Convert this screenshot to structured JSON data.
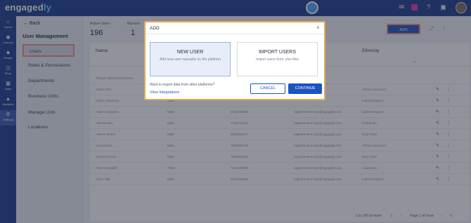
{
  "topbar": {
    "logo_main": "engaged",
    "logo_accent": "ly",
    "icons": [
      "bell-icon",
      "app-badge-icon",
      "help-icon",
      "gift-icon"
    ]
  },
  "leftnav": {
    "items": [
      {
        "icon": "home-icon",
        "label": "Home"
      },
      {
        "icon": "connect-icon",
        "label": "Connect"
      },
      {
        "icon": "people-icon",
        "label": "People"
      },
      {
        "icon": "store-icon",
        "label": "Store"
      },
      {
        "icon": "apps-icon",
        "label": "Apps"
      },
      {
        "icon": "analytics-icon",
        "label": "Analytics"
      },
      {
        "icon": "settings-icon",
        "label": "Settings"
      }
    ]
  },
  "sidebar": {
    "back_label": "Back",
    "title": "User Management",
    "items": [
      {
        "label": "Users"
      },
      {
        "label": "Roles & Permissions"
      },
      {
        "label": "Departments"
      },
      {
        "label": "Business Units"
      },
      {
        "label": "Manage Lists"
      },
      {
        "label": "Locations"
      }
    ]
  },
  "stats": {
    "active_label": "Active Users",
    "active_value": "196",
    "blocked_label": "Blocked",
    "blocked_value": "1"
  },
  "toolbar": {
    "add_label": "ADD"
  },
  "table": {
    "headers": {
      "name": "Name",
      "ethnicity": "Ethnicity"
    },
    "rows": [
      {
        "name": "Abhaya Narasimha Rasmu",
        "gender": "",
        "phone": "",
        "email": ".com",
        "ethnicity": ""
      },
      {
        "name": "Adrian Ellis",
        "gender": "Male",
        "phone": "",
        "email": "",
        "ethnicity": "African American"
      },
      {
        "name": "Adrian Meadows",
        "gender": "Male",
        "phone": "",
        "email": "",
        "ethnicity": "Latino/Hispanic"
      },
      {
        "name": "Aiden Livingston",
        "gender": "Male",
        "phone": "9731782929",
        "email": "sagetree.test+a11@cpgapply.com",
        "ethnicity": "Latino/Hispanic"
      },
      {
        "name": "Alberta Reis",
        "gender": "Male",
        "phone": "7109712522",
        "email": "sagetree.test+a11@cpgapply.com",
        "ethnicity": "Caribbean"
      },
      {
        "name": "Alberto Marsh",
        "gender": "Male",
        "phone": "8652364527",
        "email": "sagetree.test+a11@cpgapply.com",
        "ethnicity": "East Asian"
      },
      {
        "name": "Alexa Bates",
        "gender": "Male",
        "phone": "7022996723",
        "email": "sagetree.test+a11@cpgapply.com",
        "ethnicity": "African American"
      },
      {
        "name": "Alexis Kinnard",
        "gender": "Male",
        "phone": "7806651549",
        "email": "sagetree.test+a11@cpgapply.com",
        "ethnicity": "East Asian"
      },
      {
        "name": "Alice Campbell",
        "gender": "Other",
        "phone": "7121548090",
        "email": "sagetree.test+a11@cpgapply.com",
        "ethnicity": "Caucasian"
      },
      {
        "name": "Alice Little",
        "gender": "Male",
        "phone": "9451295553",
        "email": "sagetree.test+a11@cpgapply.com",
        "ethnicity": "Latino/Hispanic"
      }
    ],
    "pagination": {
      "range": "1 to 100 of more",
      "page": "Page 1 of more"
    }
  },
  "modal": {
    "title": "ADD",
    "new_user_title": "NEW USER",
    "new_user_desc": "Add new user manually on the platform",
    "import_title": "IMPORT USERS",
    "import_desc": "Import users from .xlsx files",
    "import_question": "Want to import data from other platforms?",
    "view_integrations": "View Integrations",
    "cancel_label": "CANCEL",
    "continue_label": "CONTINUE"
  }
}
